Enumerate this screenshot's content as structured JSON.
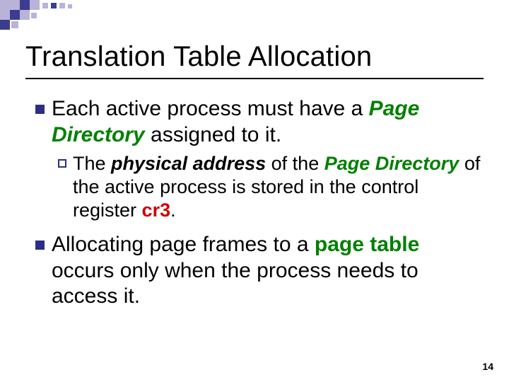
{
  "title": "Translation Table Allocation",
  "bullets": [
    {
      "pre": "Each active process must have a ",
      "em1": "Page Directory",
      "post": " assigned to it.",
      "sub": {
        "t1": "The ",
        "t2": "physical address",
        "t3": " of the ",
        "t4": "Page Directory",
        "t5": " of the active process is stored in the control register ",
        "t6": "cr3",
        "t7": "."
      }
    },
    {
      "pre": "Allocating page frames to a ",
      "em1": "page table",
      "post": " occurs only when the process needs to access it."
    }
  ],
  "pageNumber": "14",
  "deco": {
    "light": "#b9b3da",
    "dark": "#3b3d8e"
  }
}
